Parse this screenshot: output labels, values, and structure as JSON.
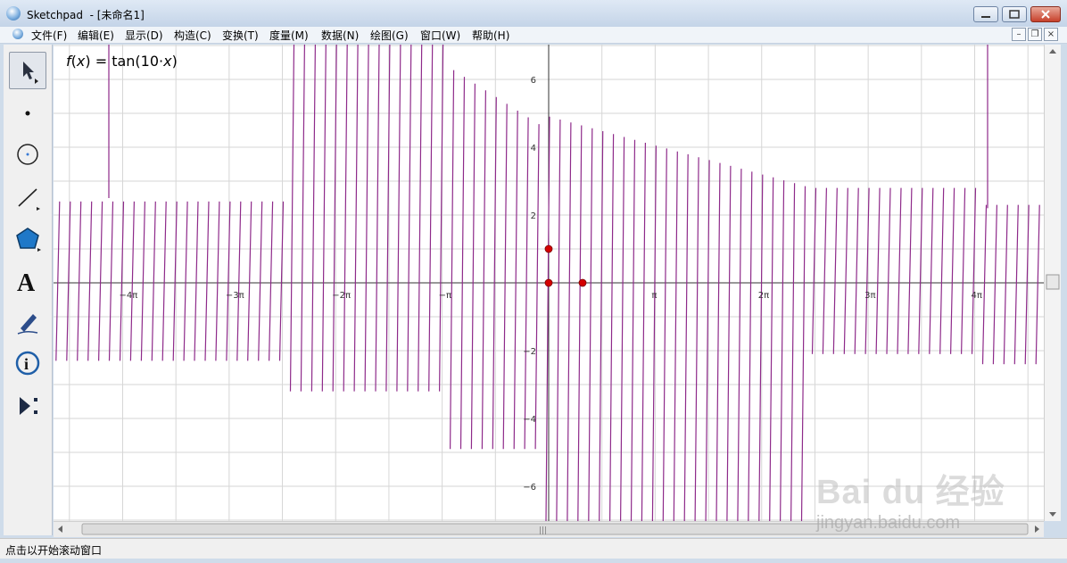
{
  "window": {
    "app_title": "Sketchpad",
    "doc_title": "  - [未命名1]"
  },
  "menu": {
    "items": [
      "文件(F)",
      "编辑(E)",
      "显示(D)",
      "构造(C)",
      "变换(T)",
      "度量(M)",
      "数据(N)",
      "绘图(G)",
      "窗口(W)",
      "帮助(H)"
    ]
  },
  "toolbox": {
    "tools": [
      "selection-arrow-tool",
      "point-tool",
      "compass-tool",
      "straightedge-tool",
      "polygon-tool",
      "text-tool",
      "marker-tool",
      "information-tool",
      "custom-tool"
    ]
  },
  "graph": {
    "function_label": "f(x) = tan(10·x)",
    "function_name": "f",
    "function_var": "x",
    "function_rhs": " = tan(10·",
    "function_close": ")",
    "curve_color": "#8e2a8a",
    "x_tick_labels": [
      "−4π",
      "−3π",
      "−2π",
      "−π",
      "π",
      "2π",
      "3π",
      "4π"
    ],
    "y_tick_labels": [
      "6",
      "4",
      "2",
      "−2",
      "−4",
      "−6"
    ],
    "point_color": "#d40000"
  },
  "status": {
    "text": "点击以开始滚动窗口"
  },
  "watermark": {
    "brand": "Bai du 经验",
    "url": "jingyan.baidu.com"
  }
}
